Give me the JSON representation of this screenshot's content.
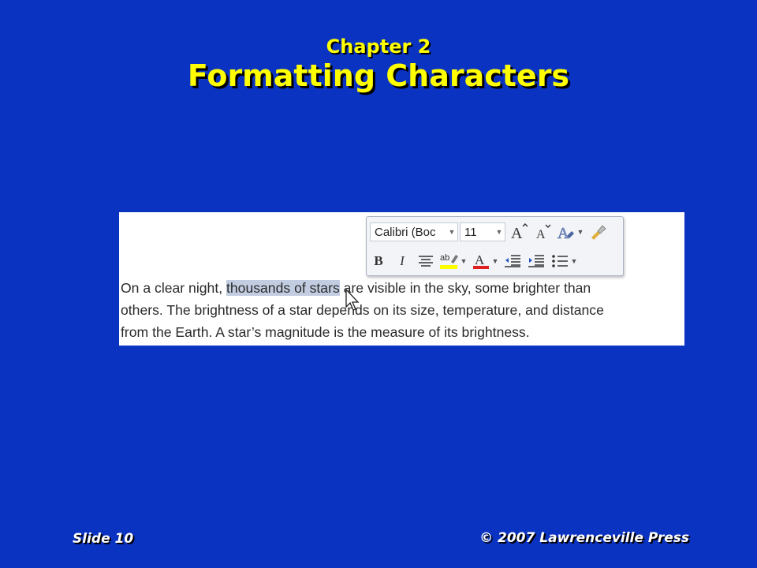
{
  "slide": {
    "chapter": "Chapter 2",
    "title": "Formatting Characters",
    "footer_left": "Slide 10",
    "footer_right": "© 2007 Lawrenceville Press"
  },
  "mini_toolbar": {
    "font_name": "Calibri (Boc",
    "font_size": "11",
    "highlight_color": "#ffff00",
    "font_color": "#e02020",
    "icons": [
      "grow-font-icon",
      "shrink-font-icon",
      "styles-icon",
      "format-painter-icon",
      "bold-icon",
      "italic-icon",
      "center-align-icon",
      "highlight-icon",
      "font-color-icon",
      "decrease-indent-icon",
      "increase-indent-icon",
      "bullets-icon"
    ]
  },
  "document": {
    "line1_before": "On a clear night, ",
    "line1_selected": "thousands of stars",
    "line1_after": " are visible in the sky, some brighter than",
    "line2": "others. The brightness of a star depends on its size, temperature, and distance",
    "line3": "from the Earth. A star’s magnitude is the measure of its brightness."
  }
}
